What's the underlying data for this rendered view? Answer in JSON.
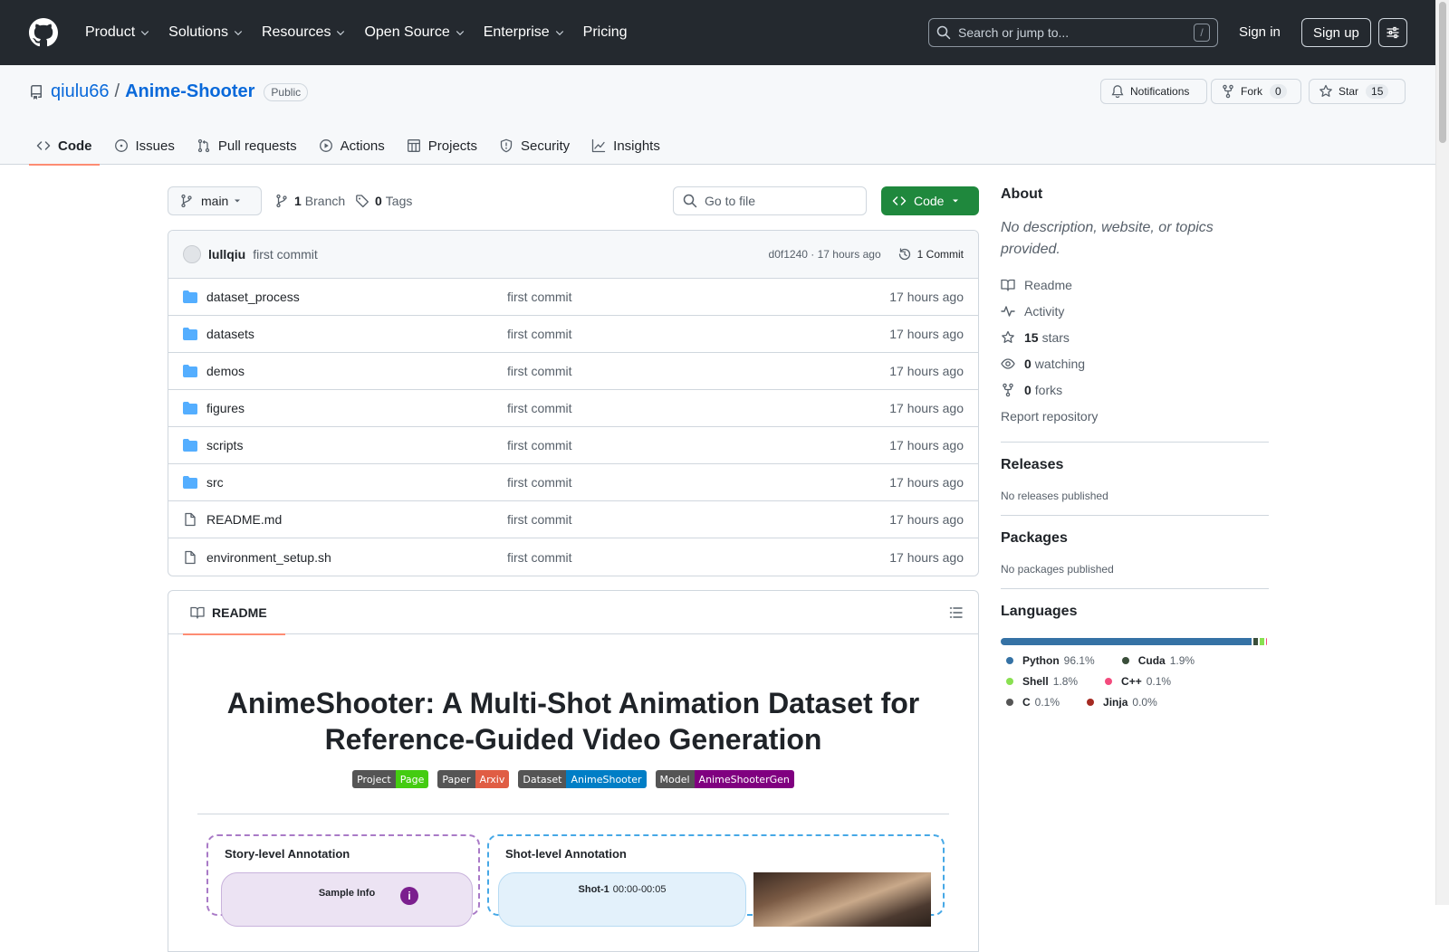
{
  "header": {
    "nav": [
      {
        "label": "Product",
        "dropdown": true
      },
      {
        "label": "Solutions",
        "dropdown": true
      },
      {
        "label": "Resources",
        "dropdown": true
      },
      {
        "label": "Open Source",
        "dropdown": true
      },
      {
        "label": "Enterprise",
        "dropdown": true
      },
      {
        "label": "Pricing",
        "dropdown": false
      }
    ],
    "search_placeholder": "Search or jump to...",
    "search_shortcut": "/",
    "signin": "Sign in",
    "signup": "Sign up"
  },
  "repo": {
    "owner": "qiulu66",
    "separator": "/",
    "name": "Anime-Shooter",
    "visibility": "Public",
    "notifications_label": "Notifications",
    "fork_label": "Fork",
    "fork_count": "0",
    "star_label": "Star",
    "star_count": "15",
    "tabs": [
      {
        "label": "Code",
        "icon": "code-icon",
        "active": true
      },
      {
        "label": "Issues",
        "icon": "issue-icon",
        "active": false
      },
      {
        "label": "Pull requests",
        "icon": "pull-request-icon",
        "active": false
      },
      {
        "label": "Actions",
        "icon": "play-icon",
        "active": false
      },
      {
        "label": "Projects",
        "icon": "table-icon",
        "active": false
      },
      {
        "label": "Security",
        "icon": "shield-icon",
        "active": false
      },
      {
        "label": "Insights",
        "icon": "graph-icon",
        "active": false
      }
    ]
  },
  "toolbar": {
    "branch": "main",
    "branch_count": "1",
    "branch_label": "Branch",
    "tag_count": "0",
    "tag_label": "Tags",
    "goto_placeholder": "Go to file",
    "code_label": "Code"
  },
  "commit": {
    "user": "lullqiu",
    "message": "first commit",
    "meta": "d0f1240 · 17 hours ago",
    "count_label": "1 Commit"
  },
  "files": [
    {
      "name": "dataset_process",
      "type": "folder",
      "message": "first commit",
      "age": "17 hours ago"
    },
    {
      "name": "datasets",
      "type": "folder",
      "message": "first commit",
      "age": "17 hours ago"
    },
    {
      "name": "demos",
      "type": "folder",
      "message": "first commit",
      "age": "17 hours ago"
    },
    {
      "name": "figures",
      "type": "folder",
      "message": "first commit",
      "age": "17 hours ago"
    },
    {
      "name": "scripts",
      "type": "folder",
      "message": "first commit",
      "age": "17 hours ago"
    },
    {
      "name": "src",
      "type": "folder",
      "message": "first commit",
      "age": "17 hours ago"
    },
    {
      "name": "README.md",
      "type": "file",
      "message": "first commit",
      "age": "17 hours ago"
    },
    {
      "name": "environment_setup.sh",
      "type": "file",
      "message": "first commit",
      "age": "17 hours ago"
    }
  ],
  "readme": {
    "tab_label": "README",
    "title_line1": "AnimeShooter: A Multi-Shot Animation Dataset for",
    "title_line2": "Reference-Guided Video Generation",
    "badges": [
      {
        "left": "Project",
        "right": "Page",
        "color": "#4c1"
      },
      {
        "left": "Paper",
        "right": "Arxiv",
        "color": "#e05d44"
      },
      {
        "left": "Dataset",
        "right": "AnimeShooter",
        "color": "#007ec6"
      },
      {
        "left": "Model",
        "right": "AnimeShooterGen",
        "color": "#800080"
      }
    ],
    "figure": {
      "story_title": "Story-level Annotation",
      "sample_info": "Sample Info",
      "shot_title": "Shot-level Annotation",
      "shot_label": "Shot-1",
      "shot_time": "00:00-00:05"
    }
  },
  "about": {
    "title": "About",
    "description": "No description, website, or topics provided.",
    "links": [
      {
        "icon": "book-icon",
        "strong": "",
        "text": "Readme"
      },
      {
        "icon": "pulse-icon",
        "strong": "",
        "text": "Activity"
      },
      {
        "icon": "star-icon",
        "strong": "15",
        "text": "stars"
      },
      {
        "icon": "eye-icon",
        "strong": "0",
        "text": "watching"
      },
      {
        "icon": "fork-icon",
        "strong": "0",
        "text": "forks"
      }
    ],
    "report": "Report repository"
  },
  "releases": {
    "title": "Releases",
    "text": "No releases published"
  },
  "packages": {
    "title": "Packages",
    "text": "No packages published"
  },
  "languages": {
    "title": "Languages",
    "items": [
      {
        "name": "Python",
        "percent": "96.1%",
        "value": 96.1,
        "color": "#3572A5"
      },
      {
        "name": "Cuda",
        "percent": "1.9%",
        "value": 1.9,
        "color": "#3A4E3A"
      },
      {
        "name": "Shell",
        "percent": "1.8%",
        "value": 1.8,
        "color": "#89e051"
      },
      {
        "name": "C++",
        "percent": "0.1%",
        "value": 0.1,
        "color": "#f34b7d"
      },
      {
        "name": "C",
        "percent": "0.1%",
        "value": 0.1,
        "color": "#555555"
      },
      {
        "name": "Jinja",
        "percent": "0.0%",
        "value": 0.0,
        "color": "#a52a22"
      }
    ]
  }
}
